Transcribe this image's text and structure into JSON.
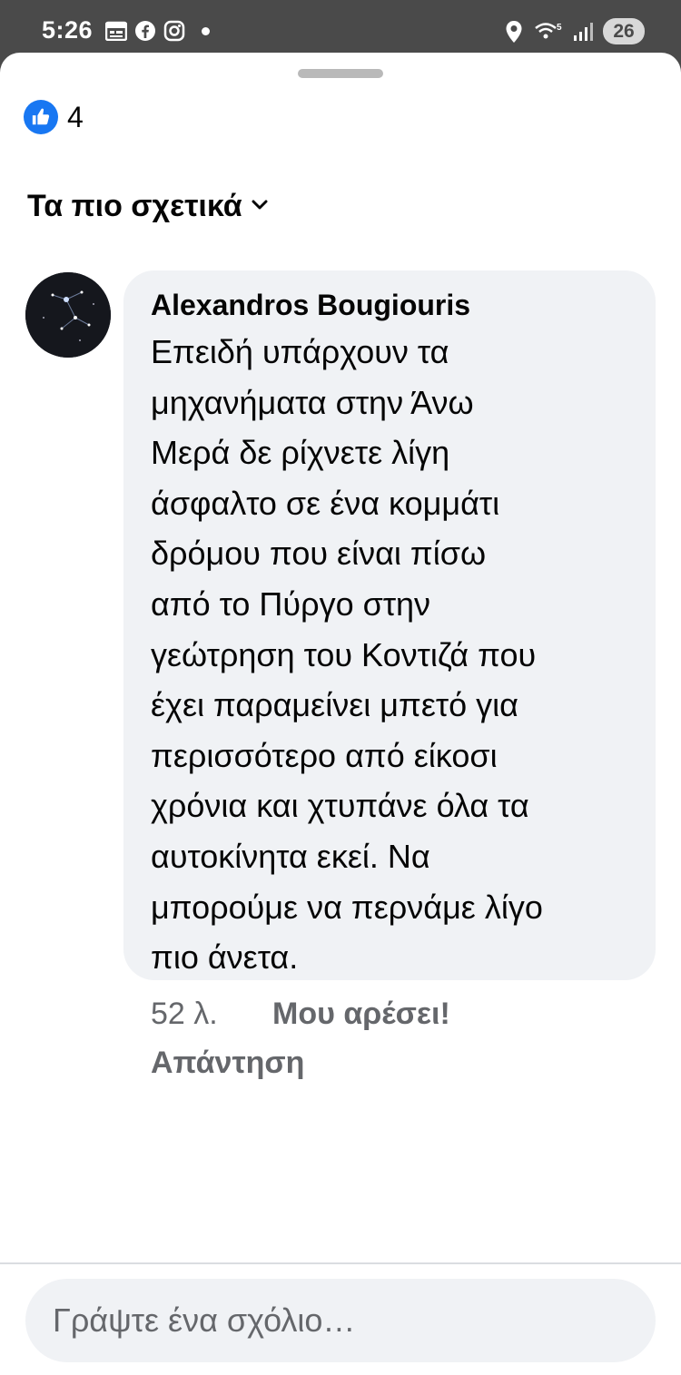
{
  "status_bar": {
    "time": "5:26",
    "left_icons": [
      "calendar-icon",
      "facebook-icon",
      "instagram-icon",
      "notification-dot-icon"
    ],
    "right_icons": [
      "location-icon",
      "wifi-icon",
      "signal-icon"
    ],
    "wifi_label": "5",
    "battery_level": "26"
  },
  "reactions": {
    "icon": "like-icon",
    "count": "4",
    "accent": "#1877f2"
  },
  "sort": {
    "label": "Τα πιο σχετικά",
    "icon": "chevron-down-icon"
  },
  "comment": {
    "author": "Alexandros Bougiouris",
    "text_lines": [
      "Επειδή υπάρχουν τα",
      "μηχανήματα στην Άνω",
      "Μερά δε ρίχνετε λίγη",
      "άσφαλτο σε ένα κομμάτι",
      "δρόμου που είναι πίσω",
      "από το Πύργο στην",
      "γεώτρηση του Κοντιζά που",
      "έχει παραμείνει μπετό για",
      "περισσότερο από είκοσι",
      "χρόνια και χτυπάνε όλα τα",
      "αυτοκίνητα εκεί. Να",
      "μπορούμε να περνάμε λίγο",
      "πιο άνετα."
    ],
    "time_ago": "52 λ.",
    "like_label": "Μου αρέσει!",
    "reply_label": "Απάντηση"
  },
  "composer": {
    "placeholder": "Γράψτε ένα σχόλιο…"
  }
}
